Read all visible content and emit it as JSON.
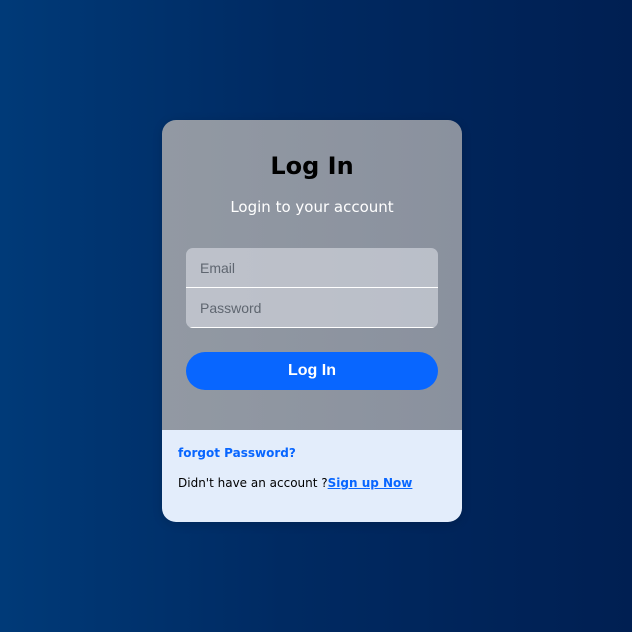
{
  "login": {
    "title": "Log In",
    "subtitle": "Login to your account",
    "email_placeholder": "Email",
    "password_placeholder": "Password",
    "button_label": "Log In"
  },
  "footer": {
    "forgot_label": "forgot Password?",
    "no_account_text": "Didn't have an account ?",
    "signup_label": "Sign up Now"
  },
  "colors": {
    "background_left": "#003a78",
    "background_right": "#001f52",
    "card_top": "#8f96a1",
    "card_bottom": "#e3edfb",
    "accent": "#0866ff"
  }
}
